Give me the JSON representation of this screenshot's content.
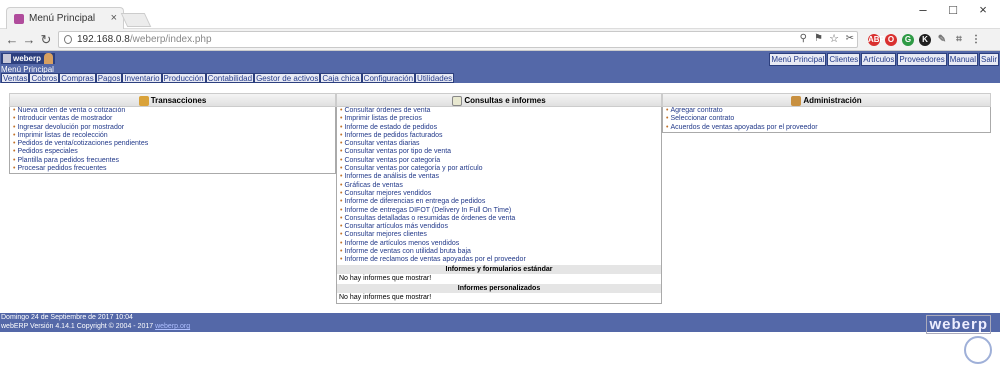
{
  "browser": {
    "tab_title": "Menú Principal",
    "url_host": "192.168.0.8",
    "url_path": "/weberp/index.php",
    "extensions": [
      {
        "name": "adblock-icon",
        "color": "#d9302f",
        "label": "ABP"
      },
      {
        "name": "opera-icon",
        "color": "#d9302f",
        "label": ""
      },
      {
        "name": "grammar-icon",
        "color": "#2e9a45",
        "label": "G"
      },
      {
        "name": "user-icon",
        "color": "#1f1f1f",
        "label": "K"
      }
    ]
  },
  "app": {
    "brand": "weberp",
    "menu_label": "Menú Principal",
    "top_links": [
      "Menú Principal",
      "Clientes",
      "Artículos",
      "Proveedores",
      "Manual",
      "Salir"
    ],
    "module_tabs": [
      "Ventas",
      "Cobros",
      "Compras",
      "Pagos",
      "Inventario",
      "Producción",
      "Contabilidad",
      "Gestor de activos",
      "Caja chica",
      "Configuración",
      "Utilidades"
    ]
  },
  "panels": {
    "transacciones": {
      "title": "Transacciones",
      "items": [
        "Nueva orden de venta o cotización",
        "Introducir ventas de mostrador",
        "Ingresar devolución por mostrador",
        "Imprimir listas de recolección",
        "Pedidos de venta/cotizaciones pendientes",
        "Pedidos especiales",
        "Plantilla para pedidos frecuentes",
        "Procesar pedidos frecuentes"
      ]
    },
    "consultas": {
      "title": "Consultas e informes",
      "items": [
        "Consultar órdenes de venta",
        "Imprimir listas de precios",
        "Informe de estado de pedidos",
        "Informes de pedidos facturados",
        "Consultar ventas diarias",
        "Consultar ventas por tipo de venta",
        "Consultar ventas por categoría",
        "Consultar ventas por categoría y por artículo",
        "Informes de análisis de ventas",
        "Gráficas de ventas",
        "Consultar mejores vendidos",
        "Informe de diferencias en entrega de pedidos",
        "Informe de entregas DIFOT (Delivery In Full On Time)",
        "Consultas detalladas o resumidas de órdenes de venta",
        "Consultar artículos más vendidos",
        "Consultar mejores clientes",
        "Informe de artículos menos vendidos",
        "Informe de ventas con utilidad bruta baja",
        "Informe de reclamos de ventas apoyadas por el proveedor"
      ],
      "std_title": "Informes y formularios estándar",
      "std_empty": "No hay informes que mostrar!",
      "custom_title": "Informes personalizados",
      "custom_empty": "No hay informes que mostrar!"
    },
    "administracion": {
      "title": "Administración",
      "items": [
        "Agregar contrato",
        "Seleccionar contrato",
        "Acuerdos de ventas apoyadas por el proveedor"
      ]
    }
  },
  "footer": {
    "date": "Domingo 24 de Septiembre de 2017 10:04",
    "version": "webERP Versión 4.14.1 Copyright © 2004 - 2017",
    "site": "weberp.org",
    "logo": "weberp"
  }
}
